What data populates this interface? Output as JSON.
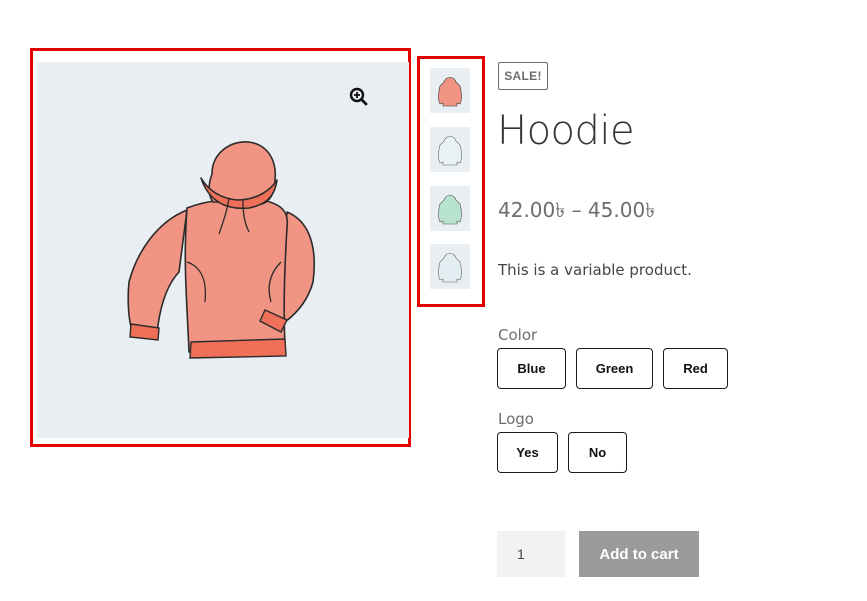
{
  "badge": "SALE!",
  "product": {
    "title": "Hoodie",
    "price_range": "42.00৳ – 45.00৳",
    "description": "This is a variable product."
  },
  "attributes": {
    "color": {
      "label": "Color",
      "options": [
        "Blue",
        "Green",
        "Red"
      ]
    },
    "logo": {
      "label": "Logo",
      "options": [
        "Yes",
        "No"
      ]
    }
  },
  "cart": {
    "quantity": "1",
    "add_label": "Add to cart"
  },
  "gallery": {
    "zoom_icon": "zoom-in-icon",
    "thumbnails": [
      "hoodie-red",
      "hoodie-blue",
      "hoodie-green",
      "hoodie-blue-light"
    ]
  },
  "colors": {
    "hoodie": "#f08f7d",
    "highlight": "#e50000",
    "button_disabled": "#9b9b9b"
  }
}
